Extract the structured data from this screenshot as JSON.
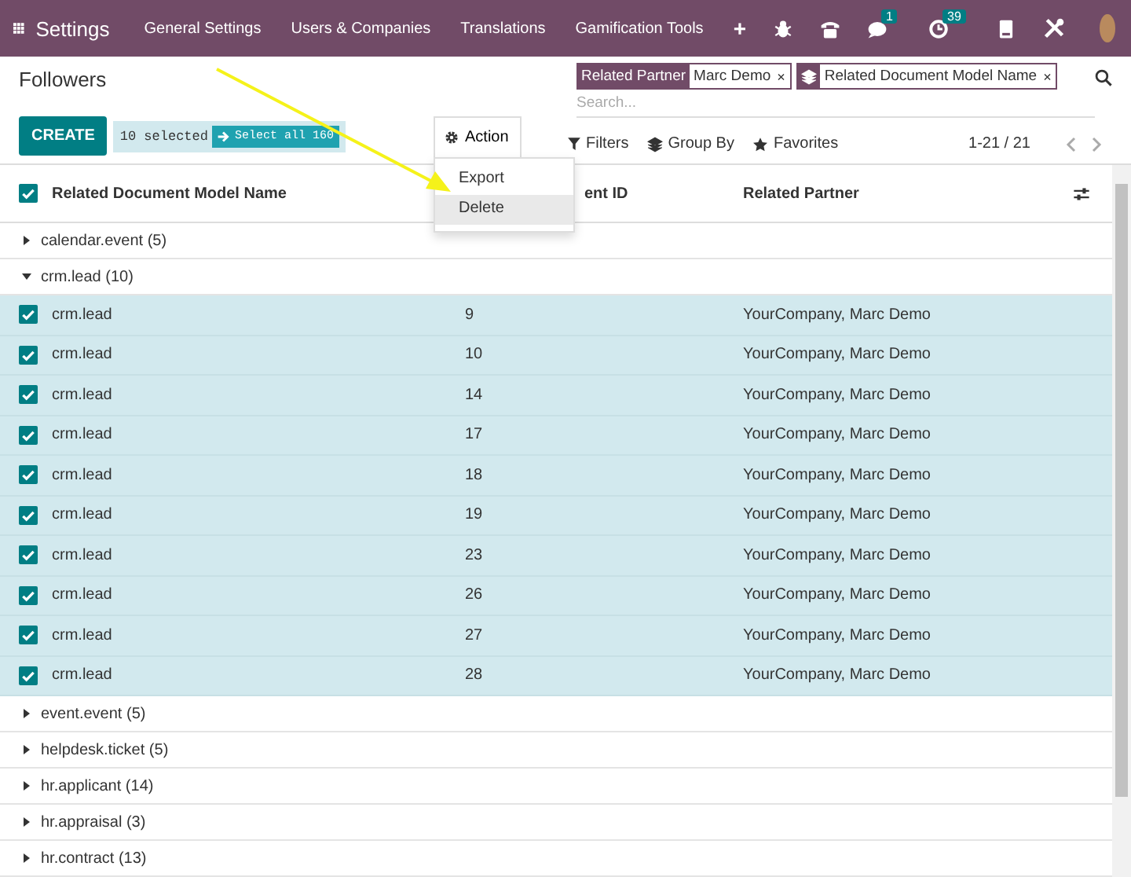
{
  "navbar": {
    "app_name": "Settings",
    "menus": [
      "General Settings",
      "Users & Companies",
      "Translations",
      "Gamification Tools"
    ],
    "plus": "+",
    "message_count": "1",
    "activity_count": "39"
  },
  "control_panel": {
    "title": "Followers",
    "facets": [
      {
        "kind": "label",
        "label": "Related Partner",
        "value": "Marc Demo",
        "remove": "×"
      },
      {
        "kind": "group",
        "value": "Related Document Model Name",
        "remove": "×"
      }
    ],
    "search_placeholder": "Search...",
    "create": "CREATE",
    "selected_count": "10 selected",
    "select_all": "Select all 160",
    "action": "Action",
    "action_menu": [
      {
        "label": "Export",
        "selected": false
      },
      {
        "label": "Delete",
        "selected": true
      }
    ],
    "filters": "Filters",
    "group_by": "Group By",
    "favorites": "Favorites",
    "pager": "1-21 / 21"
  },
  "table": {
    "header_checked": true,
    "columns": [
      "Related Document Model Name",
      "ent ID",
      "Related Partner"
    ],
    "groups": [
      {
        "label": "calendar.event (5)",
        "expanded": false
      },
      {
        "label": "crm.lead (10)",
        "expanded": true,
        "rows": [
          {
            "selected": true,
            "cells": [
              "crm.lead",
              "9",
              "YourCompany, Marc Demo"
            ]
          },
          {
            "selected": true,
            "cells": [
              "crm.lead",
              "10",
              "YourCompany, Marc Demo"
            ]
          },
          {
            "selected": true,
            "cells": [
              "crm.lead",
              "14",
              "YourCompany, Marc Demo"
            ]
          },
          {
            "selected": true,
            "cells": [
              "crm.lead",
              "17",
              "YourCompany, Marc Demo"
            ]
          },
          {
            "selected": true,
            "cells": [
              "crm.lead",
              "18",
              "YourCompany, Marc Demo"
            ]
          },
          {
            "selected": true,
            "cells": [
              "crm.lead",
              "19",
              "YourCompany, Marc Demo"
            ]
          },
          {
            "selected": true,
            "cells": [
              "crm.lead",
              "23",
              "YourCompany, Marc Demo"
            ]
          },
          {
            "selected": true,
            "cells": [
              "crm.lead",
              "26",
              "YourCompany, Marc Demo"
            ]
          },
          {
            "selected": true,
            "cells": [
              "crm.lead",
              "27",
              "YourCompany, Marc Demo"
            ]
          },
          {
            "selected": true,
            "cells": [
              "crm.lead",
              "28",
              "YourCompany, Marc Demo"
            ]
          }
        ]
      },
      {
        "label": "event.event (5)",
        "expanded": false
      },
      {
        "label": "helpdesk.ticket (5)",
        "expanded": false
      },
      {
        "label": "hr.applicant (14)",
        "expanded": false
      },
      {
        "label": "hr.appraisal (3)",
        "expanded": false
      },
      {
        "label": "hr.contract (13)",
        "expanded": false
      }
    ]
  }
}
